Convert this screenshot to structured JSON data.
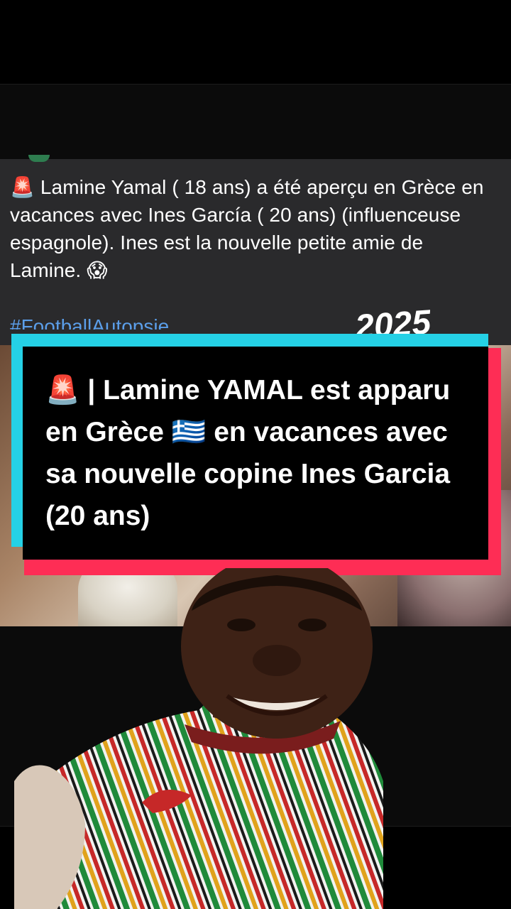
{
  "post": {
    "alert_icon": "🚨",
    "text": "Lamine Yamal ( 18 ans) a été aperçu en Grèce en vacances avec Ines García ( 20 ans) (influenceuse espagnole). Ines est la nouvelle petite amie de Lamine.",
    "shock_icon": "😱",
    "hashtag": "#FootballAutopsie",
    "watermark": "2025"
  },
  "headline": {
    "alert_icon": "🚨",
    "prefix": "| Lamine YAMAL est apparu en Grèce",
    "flag_icon": "🇬🇷",
    "suffix": "en vacances avec sa nouvelle copine Ines Garcia (20 ans)"
  },
  "colors": {
    "accent_cyan": "#25d1e6",
    "accent_pink": "#fe2d55",
    "hashtag_blue": "#5b9ee9",
    "post_bg": "#2a2a2c"
  }
}
